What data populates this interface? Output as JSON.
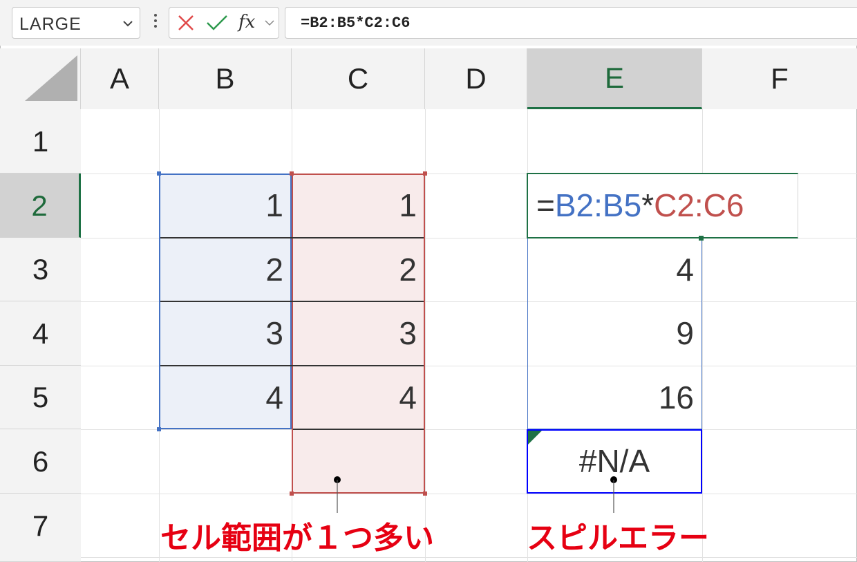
{
  "name_box": {
    "value": "LARGE"
  },
  "formula_bar": {
    "value": "=B2:B5*C2:C6"
  },
  "columns": [
    "A",
    "B",
    "C",
    "D",
    "E",
    "F"
  ],
  "rows": [
    "1",
    "2",
    "3",
    "4",
    "5",
    "6",
    "7"
  ],
  "cells": {
    "B2": "1",
    "B3": "2",
    "B4": "3",
    "B5": "4",
    "C2": "1",
    "C3": "2",
    "C4": "3",
    "C5": "4",
    "E3": "4",
    "E4": "9",
    "E5": "16",
    "E6": "#N/A"
  },
  "in_cell_formula": {
    "eq": "=",
    "ref1": "B2:B5",
    "op": "*",
    "ref2": "C2:C6"
  },
  "annotations": {
    "left_note": "セル範囲が１つ多い",
    "right_note": "スピルエラー"
  },
  "colors": {
    "ref_blue": "#4472c4",
    "ref_red": "#c0504d",
    "blue_fill": "#ecf0f8",
    "red_fill": "#f8ebeb",
    "selection_green": "#1e7145",
    "annotation_red": "#e60012",
    "error_border": "#0000ff"
  },
  "icons": [
    "chevron-down-icon",
    "more-icon",
    "cancel-icon",
    "enter-icon",
    "fx-icon"
  ]
}
